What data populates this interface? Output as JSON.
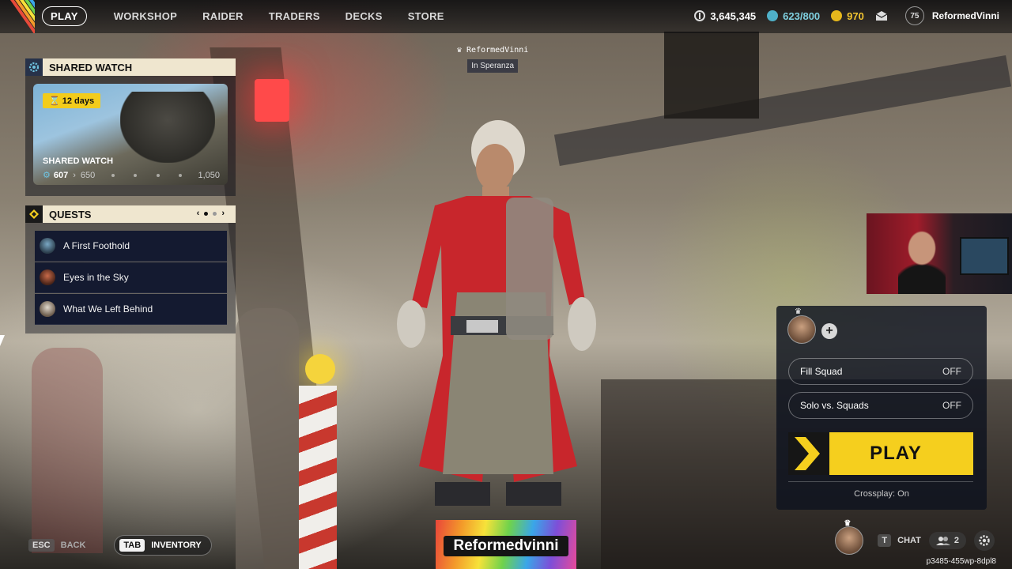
{
  "nav": {
    "tabs": [
      "PLAY",
      "WORKSHOP",
      "RAIDER",
      "TRADERS",
      "DECKS",
      "STORE"
    ],
    "active": "PLAY"
  },
  "currencies": {
    "coins": "3,645,345",
    "raider_tokens": "623/800",
    "premium": "970"
  },
  "profile": {
    "level": "75",
    "username": "ReformedVinni"
  },
  "shared_watch": {
    "header": "SHARED WATCH",
    "days": "12 days",
    "title": "SHARED WATCH",
    "progress_current": "607",
    "progress_next": "650",
    "progress_max": "1,050"
  },
  "quests": {
    "header": "QUESTS",
    "items": [
      {
        "label": "A First Foothold",
        "icon": "quest-giver-avatar-icon"
      },
      {
        "label": "Eyes in the Sky",
        "icon": "quest-giver-avatar-icon"
      },
      {
        "label": "What We Left Behind",
        "icon": "quest-giver-avatar-icon"
      }
    ]
  },
  "player_tag": {
    "name": "ReformedVinni",
    "location": "In Speranza"
  },
  "squad": {
    "fill_squad_label": "Fill Squad",
    "fill_squad_value": "OFF",
    "solo_label": "Solo vs. Squads",
    "solo_value": "OFF",
    "play_label": "PLAY",
    "crossplay": "Crossplay: On"
  },
  "bottom": {
    "esc_key": "ESC",
    "back_label": "BACK",
    "tab_key": "TAB",
    "inventory_label": "INVENTORY",
    "chat_key": "T",
    "chat_label": "CHAT",
    "friends_count": "2",
    "session_id": "p3485-455wp-8dpl8"
  },
  "streamer_overlay": {
    "name": "Reformedvinni"
  },
  "colors": {
    "accent_yellow": "#f5cf1e",
    "header_cream": "#efe6cf",
    "panel_navy": "#141a30"
  }
}
